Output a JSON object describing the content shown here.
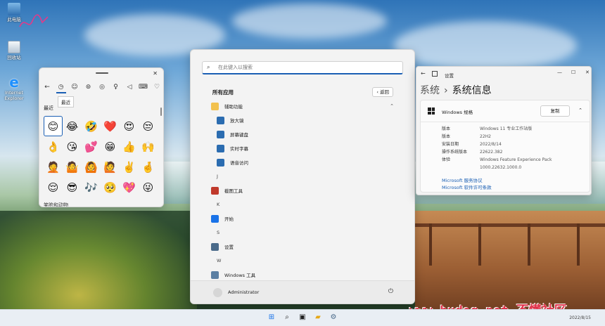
{
  "desktop": {
    "icons": [
      {
        "label": "此电脑",
        "icon": "computer-icon"
      },
      {
        "label": "回收站",
        "icon": "recycle-bin-icon"
      },
      {
        "label": "Internet Explorer",
        "icon": "ie-icon"
      }
    ]
  },
  "emoji_panel": {
    "tooltip": "最近",
    "section_recent": "最近",
    "section_next": "笑脸和动物",
    "tabs": [
      "back-icon",
      "clock-icon",
      "smiley-icon",
      "gif-icon",
      "kaomoji-icon",
      "symbols-icon",
      "clipboard-icon",
      "keyboard-icon",
      "heart-icon"
    ],
    "emojis": [
      "😊",
      "😂",
      "🤣",
      "❤️",
      "😍",
      "😒",
      "👌",
      "😘",
      "💕",
      "😁",
      "👍",
      "🙌",
      "🤦",
      "🤷",
      "🙆",
      "🙋",
      "✌️",
      "🤞",
      "😌",
      "😎",
      "🎶",
      "🥺",
      "💖",
      "😜"
    ]
  },
  "start_menu": {
    "search_placeholder": "在此键入以搜索",
    "all_apps_title": "所有应用",
    "back_label": "返回",
    "entries": [
      {
        "kind": "folder",
        "label": "辅助功能",
        "chevron": "⌃"
      },
      {
        "kind": "sub",
        "label": "放大镜",
        "color": "#2b6cb0"
      },
      {
        "kind": "sub",
        "label": "屏幕键盘",
        "color": "#2b6cb0"
      },
      {
        "kind": "sub",
        "label": "实时字幕",
        "color": "#2b6cb0"
      },
      {
        "kind": "sub",
        "label": "语音访问",
        "color": "#2b6cb0"
      },
      {
        "kind": "letter",
        "label": "J"
      },
      {
        "kind": "app",
        "label": "截图工具",
        "color": "#c0392b"
      },
      {
        "kind": "letter",
        "label": "K"
      },
      {
        "kind": "app",
        "label": "开始",
        "color": "#1a73e8"
      },
      {
        "kind": "letter",
        "label": "S"
      },
      {
        "kind": "app",
        "label": "设置",
        "color": "#4a6a8a"
      },
      {
        "kind": "letter",
        "label": "W"
      },
      {
        "kind": "app",
        "label": "Windows 工具",
        "color": "#5b7fa3"
      }
    ],
    "user_name": "Administrator"
  },
  "settings": {
    "window_title": "设置",
    "breadcrumb_parent": "系统",
    "breadcrumb_current": "系统信息",
    "spec_title": "Windows 规格",
    "copy_label": "复制",
    "rows": [
      {
        "k": "版本",
        "v": "Windows 11 专业工作站版"
      },
      {
        "k": "版本",
        "v": "22H2"
      },
      {
        "k": "安装日期",
        "v": "2022/8/14"
      },
      {
        "k": "操作系统版本",
        "v": "22622.382"
      },
      {
        "k": "体验",
        "v": "Windows Feature Experience Pack"
      },
      {
        "k": "",
        "v": "1000.22632.1000.0"
      }
    ],
    "links": [
      "Microsoft 服务协议",
      "Microsoft 软件许可条款"
    ]
  },
  "taskbar": {
    "items": [
      "windows-start-icon",
      "search-icon",
      "task-view-icon",
      "file-explorer-icon",
      "settings-icon"
    ],
    "clock": "2022/8/15"
  },
  "watermark": "www.budog.net 不懂社区"
}
